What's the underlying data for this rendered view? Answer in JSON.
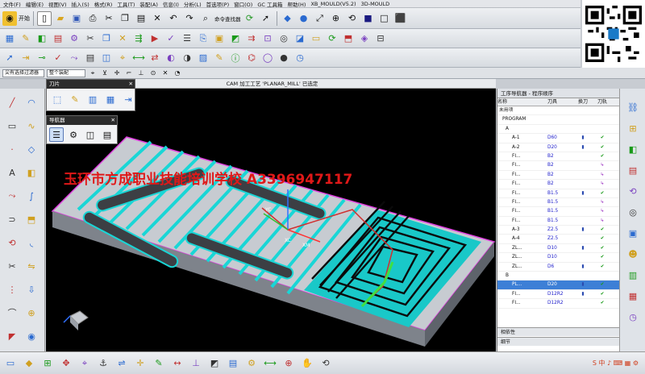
{
  "menu": [
    "文件(F)",
    "编辑(E)",
    "视图(V)",
    "插入(S)",
    "格式(R)",
    "工具(T)",
    "装配(A)",
    "信息(I)",
    "分析(L)",
    "首选项(P)",
    "窗口(O)",
    "GC 工具箱",
    "帮助(H)",
    "XB_MOULD(V5.2)",
    "3D-MOULD"
  ],
  "toolbar": {
    "start_label": "开始",
    "cmd_finder_label": "命令查找器"
  },
  "selection_bar": {
    "filter": "尖有选择过滤器",
    "scope": "整个装配"
  },
  "status_message": "CAM 加工工艺 'PLANAR_MILL' 已选定",
  "tool_panel": {
    "title": "刀片"
  },
  "navigator_panel": {
    "title": "导航器"
  },
  "watermark": "玉环市方成职业技能培训学校 A3396947117",
  "axes": {
    "xc": "XC",
    "xm": "XM",
    "yc": "YC"
  },
  "op_navigator": {
    "title": "工序导航器 - 程序顺序",
    "columns": [
      "名称",
      "刀具",
      "换刀",
      "刀轨"
    ],
    "rows": [
      {
        "name": "未用项",
        "tool": "",
        "chg": "",
        "ok": ""
      },
      {
        "name": "PROGRAM",
        "tool": "",
        "chg": "",
        "ok": ""
      },
      {
        "name": "A",
        "tool": "",
        "chg": "",
        "ok": ""
      },
      {
        "name": "A-1",
        "tool": "D60",
        "chg": "▮",
        "ok": "✔"
      },
      {
        "name": "A-2",
        "tool": "D20",
        "chg": "▮",
        "ok": "✔"
      },
      {
        "name": "FI...",
        "tool": "B2",
        "chg": "",
        "ok": "✔"
      },
      {
        "name": "FI...",
        "tool": "B2",
        "chg": "",
        "ok": "↳"
      },
      {
        "name": "FI...",
        "tool": "B2",
        "chg": "",
        "ok": "↳"
      },
      {
        "name": "FI...",
        "tool": "B2",
        "chg": "",
        "ok": "↳"
      },
      {
        "name": "FI...",
        "tool": "B1.5",
        "chg": "▮",
        "ok": "✔"
      },
      {
        "name": "FI...",
        "tool": "B1.5",
        "chg": "",
        "ok": "↳"
      },
      {
        "name": "FI...",
        "tool": "B1.5",
        "chg": "",
        "ok": "↳"
      },
      {
        "name": "FI...",
        "tool": "B1.5",
        "chg": "",
        "ok": "↳"
      },
      {
        "name": "A-3",
        "tool": "Z2.5",
        "chg": "▮",
        "ok": "✔"
      },
      {
        "name": "A-4",
        "tool": "Z2.5",
        "chg": "",
        "ok": "✔"
      },
      {
        "name": "ZL...",
        "tool": "D10",
        "chg": "▮",
        "ok": "✔"
      },
      {
        "name": "ZL...",
        "tool": "D10",
        "chg": "",
        "ok": "✔"
      },
      {
        "name": "ZL...",
        "tool": "D6",
        "chg": "▮",
        "ok": "✔"
      },
      {
        "name": "B",
        "tool": "",
        "chg": "",
        "ok": ""
      },
      {
        "name": "PL...",
        "tool": "D20",
        "chg": "▮",
        "ok": "✔"
      },
      {
        "name": "FI...",
        "tool": "D12R2",
        "chg": "▮",
        "ok": "✔"
      },
      {
        "name": "FI...",
        "tool": "D12R2",
        "chg": "",
        "ok": "✔"
      }
    ],
    "footer": [
      "相依性",
      "细节"
    ]
  },
  "colors": {
    "cyan": "#19d6d6",
    "part_gray": "#bfc3c9",
    "highlight": "#3d7fd6",
    "watermark": "#e01818"
  }
}
